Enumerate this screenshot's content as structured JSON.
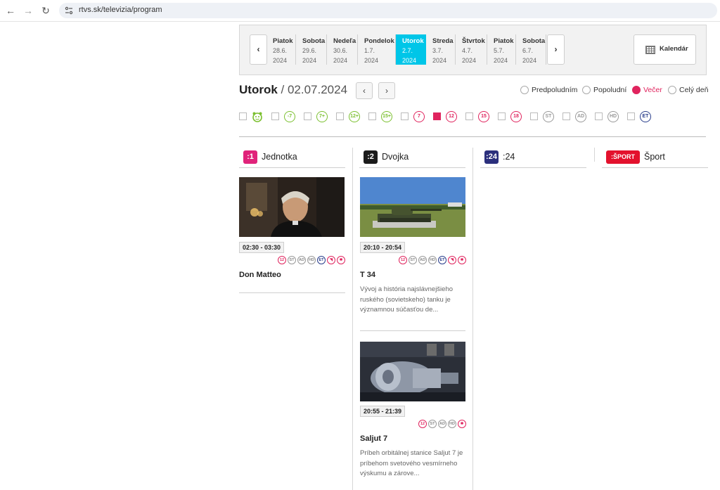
{
  "browser": {
    "url": "rtvs.sk/televizia/program"
  },
  "date_strip": {
    "prev": "‹",
    "next": "›",
    "days": [
      {
        "name": "Piatok",
        "date": "28.6.",
        "year": "2024"
      },
      {
        "name": "Sobota",
        "date": "29.6.",
        "year": "2024"
      },
      {
        "name": "Nedeľa",
        "date": "30.6.",
        "year": "2024"
      },
      {
        "name": "Pondelok",
        "date": "1.7.",
        "year": "2024"
      },
      {
        "name": "Utorok",
        "date": "2.7.",
        "year": "2024"
      },
      {
        "name": "Streda",
        "date": "3.7.",
        "year": "2024"
      },
      {
        "name": "Štvrtok",
        "date": "4.7.",
        "year": "2024"
      },
      {
        "name": "Piatok",
        "date": "5.7.",
        "year": "2024"
      },
      {
        "name": "Sobota",
        "date": "6.7.",
        "year": "2024"
      }
    ],
    "active_index": 4,
    "calendar_label": "Kalendár"
  },
  "heading": {
    "day": "Utorok",
    "sep": " / ",
    "date": "02.07.2024",
    "prev": "‹",
    "next": "›"
  },
  "time_filters": [
    {
      "label": "Predpoludním",
      "selected": false
    },
    {
      "label": "Popoludní",
      "selected": false
    },
    {
      "label": "Večer",
      "selected": true
    },
    {
      "label": "Celý deň",
      "selected": false
    }
  ],
  "age_filters": [
    {
      "label": "",
      "icon": "kids-icon",
      "color": "#7cc030",
      "checked": false
    },
    {
      "label": "-7",
      "color": "#7cc030",
      "checked": false
    },
    {
      "label": "7+",
      "color": "#7cc030",
      "checked": false
    },
    {
      "label": "12+",
      "color": "#7cc030",
      "checked": false
    },
    {
      "label": "15+",
      "color": "#7cc030",
      "checked": false
    },
    {
      "label": "7",
      "color": "#e0245e",
      "checked": false
    },
    {
      "label": "12",
      "color": "#e0245e",
      "checked": true
    },
    {
      "label": "15",
      "color": "#e0245e",
      "checked": false
    },
    {
      "label": "18",
      "color": "#e0245e",
      "checked": false
    },
    {
      "label": "ST",
      "color": "#999999",
      "checked": false
    },
    {
      "label": "AD",
      "color": "#999999",
      "checked": false
    },
    {
      "label": "HD",
      "color": "#999999",
      "checked": false
    },
    {
      "label": "ET",
      "color": "#2a3e8c",
      "checked": false
    }
  ],
  "channels": [
    {
      "logo": ":1",
      "name": "Jednotka",
      "color": "#e0237a"
    },
    {
      "logo": ":2",
      "name": "Dvojka",
      "color": "#1b1b1b"
    },
    {
      "logo": ":24",
      "name": ":24",
      "color": "#2b2f7c"
    },
    {
      "logo": ":ŠPORT",
      "name": "Šport",
      "color": "#e3122d"
    }
  ],
  "programs": {
    "jednotka": [
      {
        "time": "02:30 - 03:30",
        "title": "Don Matteo",
        "desc": "",
        "icons": [
          "12",
          "ST",
          "AD",
          "HD",
          "ET",
          "audio",
          "sign"
        ]
      }
    ],
    "dvojka": [
      {
        "time": "20:10 - 20:54",
        "title": "T 34",
        "desc": "Vývoj a história najslávnejšieho ruského (sovietskeho) tanku je významnou súčasťou de...",
        "icons": [
          "12",
          "ST",
          "AD",
          "HD",
          "ET",
          "audio",
          "sign"
        ]
      },
      {
        "time": "20:55 - 21:39",
        "title": "Saljut 7",
        "desc": "Príbeh orbitálnej stanice Saljut 7 je príbehom svetového vesmírneho výskumu a zárove...",
        "icons": [
          "12",
          "ST",
          "AD",
          "HD",
          "sign"
        ]
      }
    ]
  }
}
